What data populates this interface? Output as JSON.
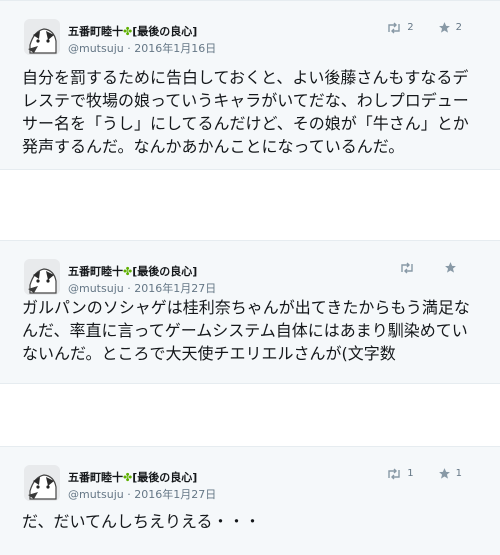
{
  "tweets": [
    {
      "display_name": "五番町睦十",
      "clover": "✤",
      "display_suffix": "[最後の良心]",
      "handle": "@mutsuju",
      "sep": " · ",
      "date": "2016年1月16日",
      "retweet_count": "2",
      "like_count": "2",
      "text": "自分を罰するために告白しておくと、よい後藤さんもすなるデ\nレステで牧場の娘っていうキャラがいてだな、わしプロデュー\nサー名を「うし」にしてるんだけど、その娘が「牛さん」とか\n発声するんだ。なんかあかんことになっているんだ。"
    },
    {
      "display_name": "五番町睦十",
      "clover": "✤",
      "display_suffix": "[最後の良心]",
      "handle": "@mutsuju",
      "sep": " · ",
      "date": "2016年1月27日",
      "retweet_count": "",
      "like_count": "",
      "text": "ガルパンのソシャゲは桂利奈ちゃんが出てきたからもう満足な\nんだ、率直に言ってゲームシステム自体にはあまり馴染めてい\nないんだ。ところで大天使チエリエルさんが(文字数"
    },
    {
      "display_name": "五番町睦十",
      "clover": "✤",
      "display_suffix": "[最後の良心]",
      "handle": "@mutsuju",
      "sep": " · ",
      "date": "2016年1月27日",
      "retweet_count": "1",
      "like_count": "1",
      "text": "だ、だいてんしちえりえる・・・"
    }
  ],
  "icons": {
    "retweet": "retweet-icon",
    "like": "star-icon",
    "avatar": "avatar-image"
  },
  "colors": {
    "card_background": "#f5f8fa",
    "text": "#14171a",
    "muted": "#657786",
    "icon": "#8899a6",
    "clover": "#5fb000"
  }
}
